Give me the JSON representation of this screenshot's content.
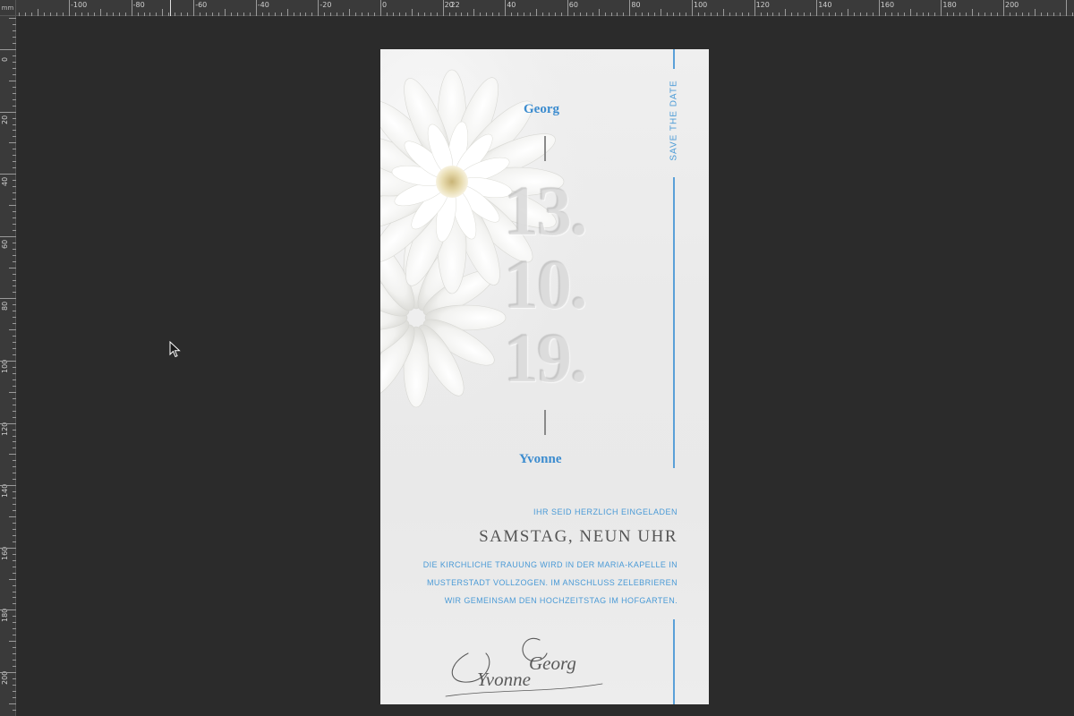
{
  "ruler": {
    "unit": "mm",
    "top_labels": [
      "-100",
      "-80",
      "-60",
      "-40",
      "-20",
      "0",
      "20",
      "40",
      "60",
      "80",
      "100",
      "120",
      "140",
      "160",
      "180",
      "200",
      "22"
    ],
    "left_labels": [
      "0",
      "20",
      "40",
      "60",
      "80",
      "100",
      "120",
      "140",
      "160",
      "180",
      "200"
    ]
  },
  "card": {
    "save_the_date": "SAVE THE DATE",
    "name_top": "Georg",
    "name_bottom": "Yvonne",
    "date": {
      "day": "13.",
      "month": "10.",
      "year": "19."
    },
    "invite_small": "IHR SEID HERZLICH EINGELADEN",
    "invite_big": "SAMSTAG, NEUN UHR",
    "invite_body": [
      "DIE KIRCHLICHE TRAUUNG WIRD IN DER MARIA-KAPELLE IN",
      "MUSTERSTADT VOLLZOGEN. IM ANSCHLUSS ZELEBRIEREN",
      "WIR  GEMEINSAM DEN HOCHZEITSTAG IM HOFGARTEN."
    ],
    "signature": {
      "line1": "Georg",
      "line2": "Yvonne"
    }
  },
  "colors": {
    "canvas": "#2b2b2b",
    "ruler": "#3a3a3a",
    "accent_blue": "#4a9ad6",
    "card_bg": "#ececec"
  },
  "icons": {
    "cursor": "arrow-pointer-icon",
    "flower": "chrysanthemum-flower-icon"
  }
}
